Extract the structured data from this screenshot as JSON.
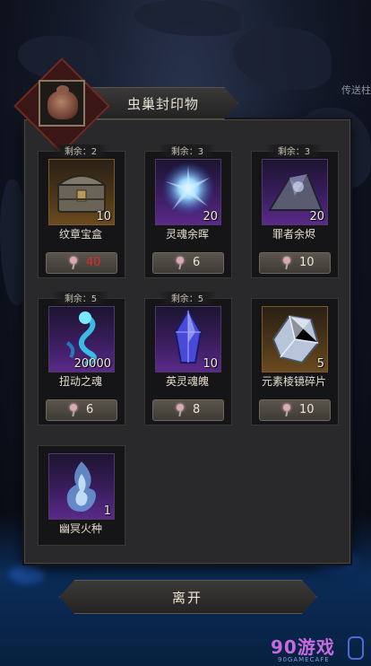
{
  "scene": {
    "corner_label": "传送柱"
  },
  "dialog": {
    "title": "虫巢封印物",
    "items": [
      {
        "remaining": "剩余：2",
        "name": "纹章宝盒",
        "qty": "10",
        "price": "40",
        "price_insufficient": true,
        "icon": "treasure-chest-icon",
        "frame": "gold"
      },
      {
        "remaining": "剩余：3",
        "name": "灵魂余晖",
        "qty": "20",
        "price": "6",
        "price_insufficient": false,
        "icon": "soul-glow-icon",
        "frame": "purple"
      },
      {
        "remaining": "剩余：3",
        "name": "罪者余烬",
        "qty": "20",
        "price": "10",
        "price_insufficient": false,
        "icon": "sinner-ember-icon",
        "frame": "purple"
      },
      {
        "remaining": "剩余：5",
        "name": "扭动之魂",
        "qty": "20000",
        "price": "6",
        "price_insufficient": false,
        "icon": "writhing-soul-icon",
        "frame": "purple"
      },
      {
        "remaining": "剩余：5",
        "name": "英灵魂魄",
        "qty": "10",
        "price": "8",
        "price_insufficient": false,
        "icon": "hero-soul-crystal-icon",
        "frame": "purple"
      },
      {
        "remaining": "",
        "name": "元素棱镜碎片",
        "qty": "5",
        "price": "10",
        "price_insufficient": false,
        "icon": "prism-shard-icon",
        "frame": "gold"
      },
      {
        "remaining": "",
        "name": "幽冥火种",
        "qty": "1",
        "price": "",
        "price_insufficient": false,
        "icon": "nether-flame-icon",
        "frame": "purple"
      }
    ],
    "leave_label": "离开"
  },
  "watermark": {
    "text": "90游戏",
    "sub": "90GAMECAFE"
  },
  "colors": {
    "price_insufficient": "#e02a22",
    "item_frame_purple": "#5a2a8a",
    "item_frame_gold": "#6a4a1e"
  }
}
